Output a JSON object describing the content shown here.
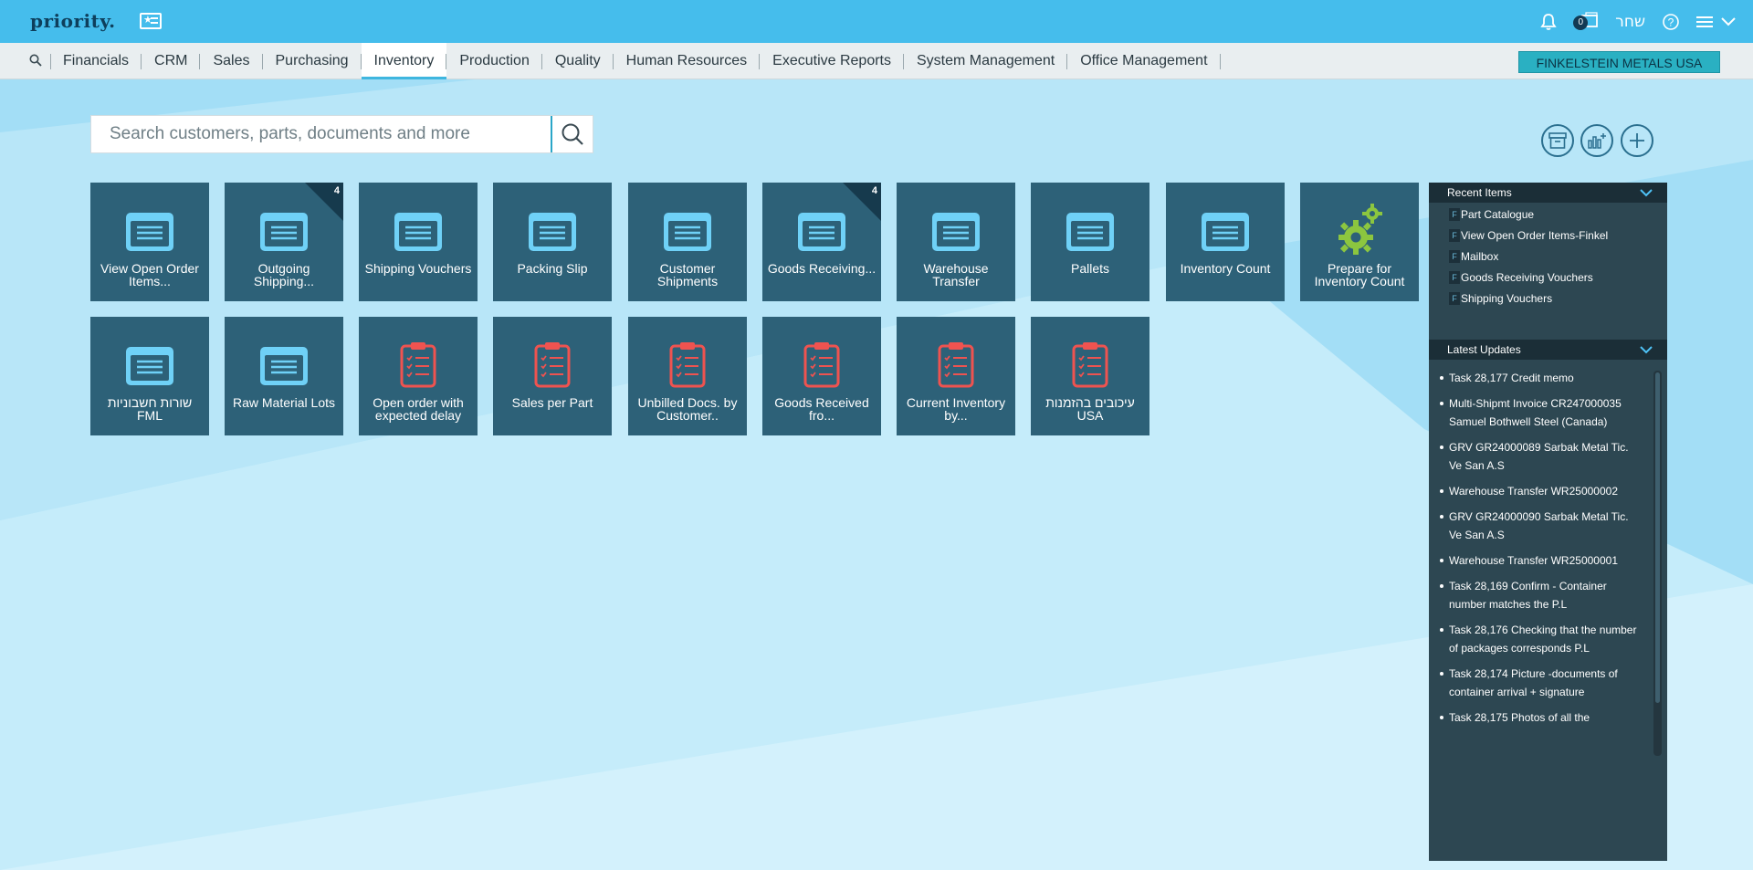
{
  "app": {
    "logo": "priority."
  },
  "header": {
    "notification_count": "0",
    "user": "שחר"
  },
  "menu": {
    "items": [
      "Financials",
      "CRM",
      "Sales",
      "Purchasing",
      "Inventory",
      "Production",
      "Quality",
      "Human Resources",
      "Executive Reports",
      "System Management",
      "Office Management"
    ],
    "active": "Inventory",
    "company": "FINKELSTEIN METALS USA"
  },
  "search": {
    "placeholder": "Search customers, parts, documents and more"
  },
  "tiles_row1": [
    {
      "label": "View Open Order Items...",
      "icon": "form-icon"
    },
    {
      "label": "Outgoing Shipping...",
      "icon": "form-icon",
      "count": "4"
    },
    {
      "label": "Shipping Vouchers",
      "icon": "form-icon"
    },
    {
      "label": "Packing Slip",
      "icon": "form-icon"
    },
    {
      "label": "Customer Shipments",
      "icon": "form-icon"
    },
    {
      "label": "Goods Receiving...",
      "icon": "form-icon",
      "count": "4"
    },
    {
      "label": "Warehouse Transfer",
      "icon": "form-icon"
    },
    {
      "label": "Pallets",
      "icon": "form-icon"
    },
    {
      "label": "Inventory Count",
      "icon": "form-icon"
    },
    {
      "label": "Prepare for Inventory Count",
      "icon": "gears-icon"
    }
  ],
  "tiles_row2": [
    {
      "label": "שורות חשבוניות FML",
      "icon": "form-icon"
    },
    {
      "label": "Raw Material Lots",
      "icon": "form-icon"
    },
    {
      "label": "Open order with expected delay",
      "icon": "clipboard-icon"
    },
    {
      "label": "Sales per Part",
      "icon": "clipboard-icon"
    },
    {
      "label": "Unbilled Docs. by Customer..",
      "icon": "clipboard-icon"
    },
    {
      "label": "Goods Received fro...",
      "icon": "clipboard-icon"
    },
    {
      "label": "Current Inventory by...",
      "icon": "clipboard-icon"
    },
    {
      "label": "עיכובים בהזמנות USA",
      "icon": "clipboard-icon"
    }
  ],
  "recent": {
    "title": "Recent Items",
    "badge": "F",
    "items": [
      "Part Catalogue",
      "View Open Order Items-Finkel",
      "Mailbox",
      "Goods Receiving Vouchers",
      "Shipping Vouchers"
    ]
  },
  "updates": {
    "title": "Latest Updates",
    "items": [
      "Task 28,177 Credit memo",
      "Multi-Shipmt Invoice CR247000035 Samuel Bothwell Steel (Canada)",
      "GRV GR24000089 Sarbak Metal Tic. Ve San A.S",
      "Warehouse Transfer WR25000002",
      "GRV GR24000090 Sarbak Metal Tic. Ve San A.S",
      "Warehouse Transfer WR25000001",
      "Task 28,169 Confirm - Container number matches the P.L",
      "Task 28,176 Checking that the number of packages corresponds P.L",
      "Task 28,174 Picture -documents of container arrival + signature",
      "Task 28,175 Photos of all the"
    ]
  },
  "colors": {
    "header": "#45bdec",
    "tile": "#2d6178",
    "panel": "#2d4752",
    "accent": "#2ab0c2",
    "form_icon": "#6fd1f7",
    "clipboard_icon": "#ef5350",
    "gear_icon": "#8cc63f"
  }
}
